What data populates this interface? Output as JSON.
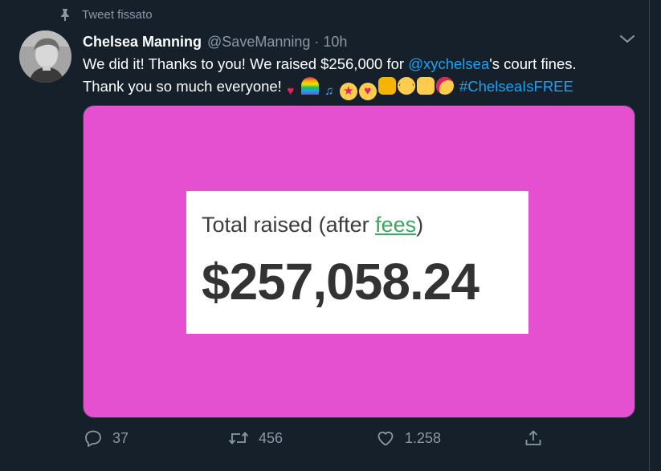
{
  "pinned_label": "Tweet fissato",
  "author": {
    "name": "Chelsea Manning",
    "handle": "@SaveManning",
    "separator": "·",
    "time": "10h"
  },
  "tweet": {
    "line1_before": "We did it! Thanks to you! We raised $256,000 for ",
    "mention": "@xychelsea",
    "line1_after": "'s court fines.",
    "line2": "Thank you so much everyone!",
    "emojis": [
      {
        "name": "red-heart",
        "glyph": "♥"
      },
      {
        "name": "rainbow",
        "glyph": ""
      },
      {
        "name": "musical-notes",
        "glyph": "♫"
      },
      {
        "name": "star-struck",
        "glyph": "★"
      },
      {
        "name": "heart-eyes",
        "glyph": "♥"
      },
      {
        "name": "folded-hands",
        "glyph": ""
      },
      {
        "name": "nerd-face",
        "glyph": ""
      },
      {
        "name": "thumbs-up",
        "glyph": ""
      },
      {
        "name": "partying-face",
        "glyph": ""
      }
    ],
    "hashtag": "#ChelseaIsFREE"
  },
  "media_card": {
    "label_before": "Total raised (after ",
    "label_link": "fees",
    "label_after": ")",
    "amount": "$257,058.24",
    "background_color": "#e450cf"
  },
  "actions": {
    "reply_count": "37",
    "retweet_count": "456",
    "like_count": "1.258"
  },
  "colors": {
    "background": "#15202b",
    "accent": "#1da1f2",
    "muted": "#8899a6"
  }
}
